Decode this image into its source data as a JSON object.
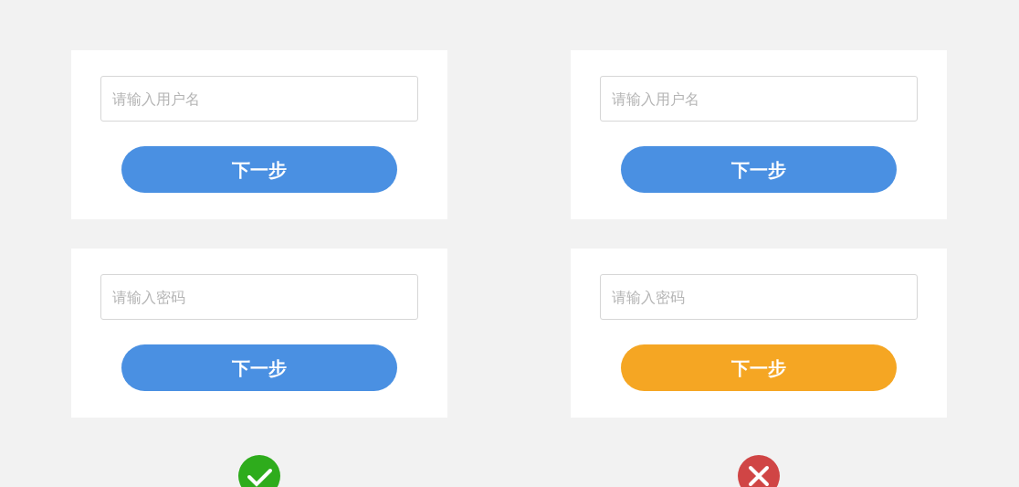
{
  "columns": [
    {
      "correct": true,
      "cards": [
        {
          "placeholder": "请输入用户名",
          "button": {
            "label": "下一步",
            "color": "#4a90e2"
          }
        },
        {
          "placeholder": "请输入密码",
          "button": {
            "label": "下一步",
            "color": "#4a90e2"
          }
        }
      ]
    },
    {
      "correct": false,
      "cards": [
        {
          "placeholder": "请输入用户名",
          "button": {
            "label": "下一步",
            "color": "#4a90e2"
          }
        },
        {
          "placeholder": "请输入密码",
          "button": {
            "label": "下一步",
            "color": "#f5a623"
          }
        }
      ]
    }
  ]
}
